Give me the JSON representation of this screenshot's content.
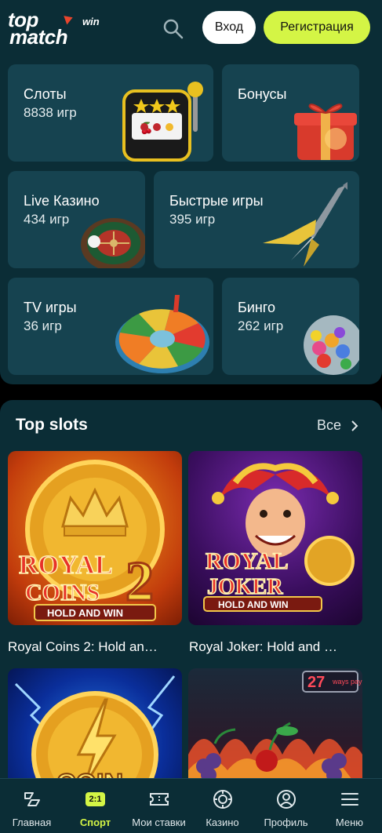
{
  "header": {
    "logo_top": "top",
    "logo_bottom": "match",
    "logo_win": "win",
    "login_label": "Вход",
    "register_label": "Регистрация"
  },
  "categories": [
    {
      "title": "Слоты",
      "count": "8838 игр"
    },
    {
      "title": "Бонусы",
      "count": ""
    },
    {
      "title": "Live Казино",
      "count": "434 игр"
    },
    {
      "title": "Быстрые игры",
      "count": "395 игр"
    },
    {
      "title": "TV игры",
      "count": "36 игр"
    },
    {
      "title": "Бинго",
      "count": "262 игр"
    }
  ],
  "top_slots": {
    "title": "Top slots",
    "all_label": "Все",
    "games": [
      {
        "name": "Royal Coins 2: Hold an…",
        "art_line1": "ROYAL",
        "art_line2": "COINS",
        "art_num": "2",
        "art_sub": "HOLD AND WIN"
      },
      {
        "name": "Royal Joker: Hold and …",
        "art_line1": "ROYAL",
        "art_line2": "JOKER",
        "art_sub": "HOLD AND WIN"
      },
      {
        "name": "",
        "art_line1": "COIN"
      },
      {
        "name": "",
        "art_badge": "27",
        "art_badge_sub": "ways pay"
      }
    ]
  },
  "bottom_nav": [
    {
      "label": "Главная",
      "icon": "home-icon"
    },
    {
      "label": "Спорт",
      "icon": "sport-badge",
      "badge": "2:1",
      "active": true
    },
    {
      "label": "Мои ставки",
      "icon": "ticket-icon"
    },
    {
      "label": "Казино",
      "icon": "casino-chip-icon"
    },
    {
      "label": "Профиль",
      "icon": "profile-icon"
    },
    {
      "label": "Меню",
      "icon": "menu-icon"
    }
  ],
  "colors": {
    "background": "#0b2d36",
    "tile": "#164350",
    "accent": "#d4f545"
  }
}
